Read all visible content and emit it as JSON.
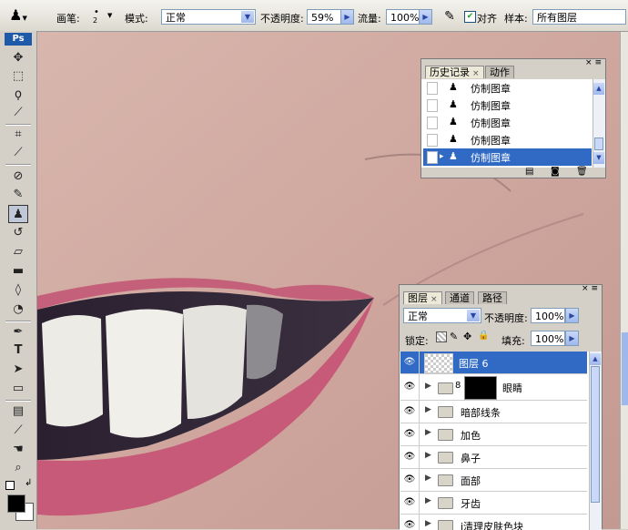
{
  "options_bar": {
    "tool_icon": "clone-stamp-icon",
    "brush_label": "画笔:",
    "brush_size": "2",
    "mode_label": "模式:",
    "mode_value": "正常",
    "opacity_label": "不透明度:",
    "opacity_value": "59%",
    "flow_label": "流量:",
    "flow_value": "100%",
    "align_label": "对齐",
    "align_checked": true,
    "sample_label": "样本:",
    "sample_value": "所有图层"
  },
  "toolbox": {
    "logo": "Ps",
    "tools": [
      "move-icon",
      "marquee-icon",
      "lasso-icon",
      "magic-wand-icon",
      "crop-icon",
      "slice-icon",
      "healing-brush-icon",
      "brush-icon",
      "clone-stamp-icon",
      "history-brush-icon",
      "eraser-icon",
      "gradient-icon",
      "blur-icon",
      "dodge-icon",
      "pen-icon",
      "type-icon",
      "path-selection-icon",
      "shape-icon",
      "notes-icon",
      "eyedropper-icon",
      "hand-icon",
      "zoom-icon"
    ],
    "foreground_color": "#000000",
    "background_color": "#ffffff"
  },
  "history_panel": {
    "tabs": [
      "历史记录",
      "动作"
    ],
    "rows": [
      {
        "label": "仿制图章",
        "selected": false
      },
      {
        "label": "仿制图章",
        "selected": false
      },
      {
        "label": "仿制图章",
        "selected": false
      },
      {
        "label": "仿制图章",
        "selected": false
      },
      {
        "label": "仿制图章",
        "selected": true
      }
    ]
  },
  "layers_panel": {
    "tabs": [
      "图层",
      "通道",
      "路径"
    ],
    "blend_mode": "正常",
    "opacity_label": "不透明度:",
    "opacity_value": "100%",
    "lock_label": "锁定:",
    "fill_label": "填充:",
    "fill_value": "100%",
    "layers": [
      {
        "name": "图层 6",
        "type": "layer",
        "selected": true
      },
      {
        "name": "眼睛",
        "type": "layer-mask",
        "selected": false
      },
      {
        "name": "暗部线条",
        "type": "group",
        "selected": false
      },
      {
        "name": "加色",
        "type": "group",
        "selected": false
      },
      {
        "name": "鼻子",
        "type": "group",
        "selected": false
      },
      {
        "name": "面部",
        "type": "group",
        "selected": false
      },
      {
        "name": "牙齿",
        "type": "group",
        "selected": false
      },
      {
        "name": "i清理皮肤色块",
        "type": "group",
        "selected": false
      }
    ]
  },
  "colors": {
    "selection": "#316ac5",
    "skin": "#cfa9a0",
    "lip": "#c4607a"
  }
}
